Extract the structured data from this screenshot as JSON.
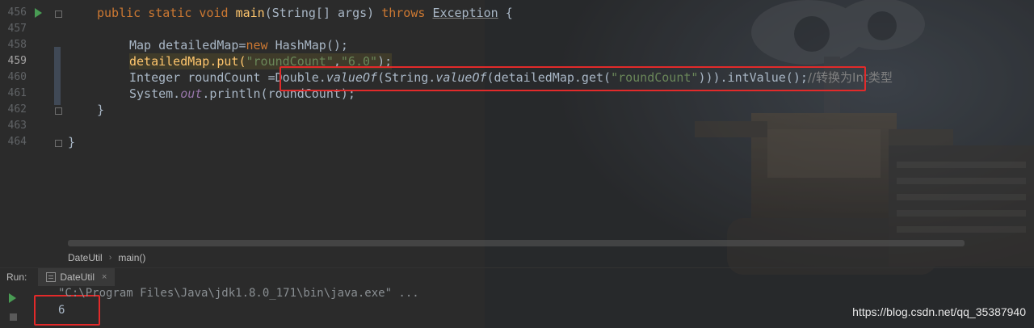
{
  "editor": {
    "line_numbers": [
      "456",
      "457",
      "458",
      "459",
      "460",
      "461",
      "462",
      "463",
      "464"
    ],
    "code": {
      "l456": {
        "kw1": "public static void ",
        "fn": "main",
        "p1": "(String[] args) ",
        "kw2": "throws ",
        "exc": "Exception",
        "p2": " {"
      },
      "l458": {
        "a": "Map detailedMap=",
        "kw": "new ",
        "b": "HashMap();"
      },
      "l459": {
        "a": "detailedMap.put(",
        "s1": "\"roundCount\"",
        "c": ",",
        "s2": "\"6.0\"",
        "d": ");"
      },
      "l460": {
        "a": "Integer roundCount =Double.",
        "f1": "valueOf",
        "b": "(String.",
        "f2": "valueOf",
        "c": "(detailedMap.get(",
        "s": "\"roundCount\"",
        "d": "))).intValue();",
        "cmt": "//转换为Int类型"
      },
      "l461": {
        "a": "System.",
        "field": "out",
        "b": ".println(roundCount);"
      },
      "l462": {
        "a": "}"
      },
      "l464": {
        "a": "}"
      }
    }
  },
  "breadcrumb": {
    "class_name": "DateUtil",
    "method_name": "main()"
  },
  "run_panel": {
    "label": "Run:",
    "tab_title": "DateUtil",
    "command_line": "\"C:\\Program Files\\Java\\jdk1.8.0_171\\bin\\java.exe\" ...",
    "output": "6"
  },
  "watermark": "https://blog.csdn.net/qq_35387940",
  "colors": {
    "background": "#2b2b2b",
    "keyword": "#cc7832",
    "string": "#6a8759",
    "method": "#ffc66d",
    "annotation_box": "#e22a2a",
    "run_green": "#499c54"
  }
}
